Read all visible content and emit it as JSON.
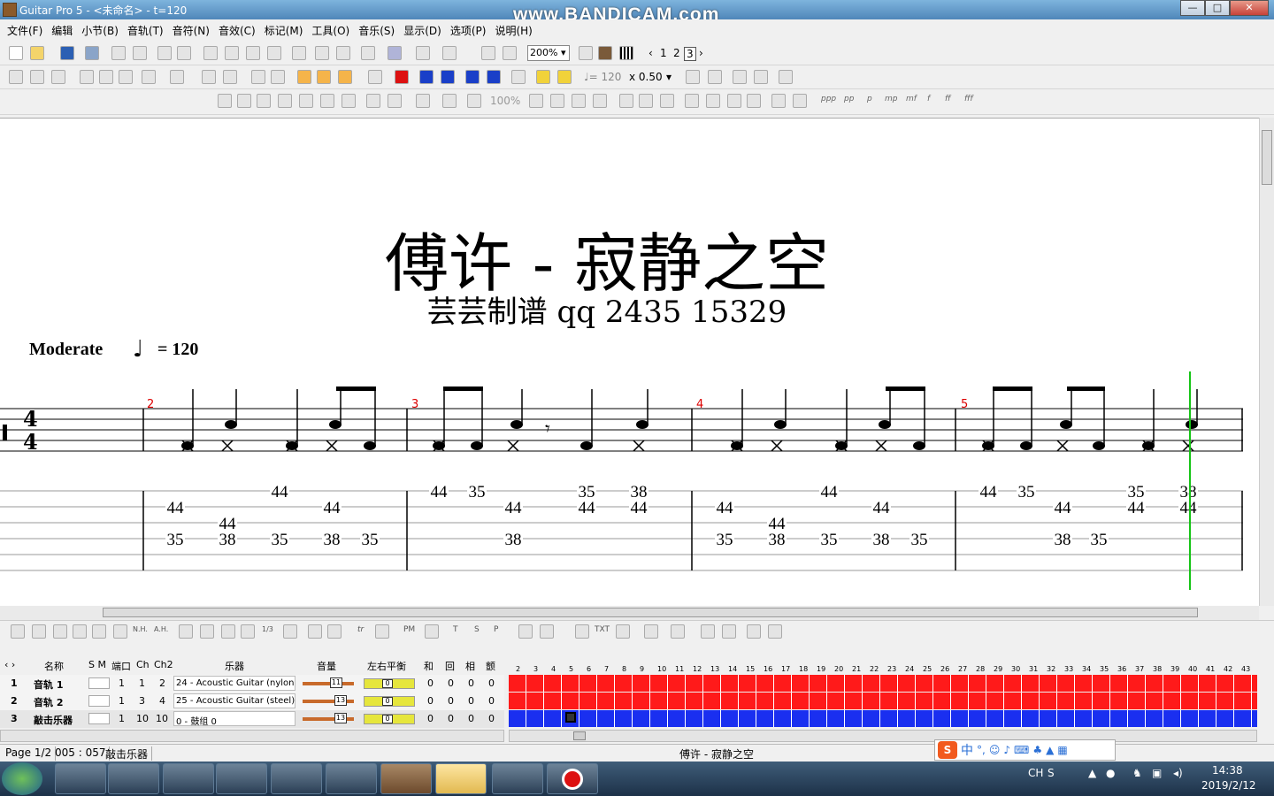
{
  "window": {
    "title": "Guitar Pro 5 - <未命名> - t=120",
    "watermark": "www.BANDICAM.com",
    "controls": {
      "minimize": "—",
      "maximize": "□",
      "close": "✕"
    }
  },
  "menu": [
    "文件(F)",
    "编辑",
    "小节(B)",
    "音轨(T)",
    "音符(N)",
    "音效(C)",
    "标记(M)",
    "工具(O)",
    "音乐(S)",
    "显示(D)",
    "选项(P)",
    "说明(H)"
  ],
  "toolbar1": {
    "zoom": "200%",
    "page_prev": "‹",
    "pages": [
      "1",
      "2",
      "3"
    ],
    "page_next": "›"
  },
  "toolbar2": {
    "tempo": "♩= 120",
    "speed": "x 0.50"
  },
  "toolbar3": {
    "percent": "100%",
    "dynamics": [
      "ppp",
      "pp",
      "p",
      "mp",
      "mf",
      "f",
      "ff",
      "fff"
    ]
  },
  "score": {
    "title": "傅许 - 寂静之空",
    "subtitle": "芸芸制谱   qq  2435  15329",
    "tempo_label": "Moderate",
    "tempo_note": "♩",
    "tempo_value": "= 120",
    "time_signature": [
      "4",
      "4"
    ],
    "measure_numbers": [
      "2",
      "3",
      "4",
      "5"
    ],
    "tab_numbers": {
      "m2": [
        [
          "44",
          "35"
        ],
        [
          "44",
          "38"
        ],
        [
          "44",
          "35"
        ],
        [
          "44",
          "38"
        ],
        [
          "35"
        ]
      ],
      "m3": [
        [
          "44"
        ],
        [
          "35"
        ],
        [
          "44",
          "38"
        ],
        [
          "35",
          "44"
        ],
        [
          "38",
          "44"
        ]
      ],
      "m4": [
        [
          "44",
          "35"
        ],
        [
          "44",
          "38"
        ],
        [
          "44",
          "35"
        ],
        [
          "44",
          "38"
        ],
        [
          "35"
        ]
      ],
      "m5": [
        [
          "44"
        ],
        [
          "35"
        ],
        [
          "44",
          "38"
        ],
        [
          "35"
        ],
        [
          "35",
          "44"
        ],
        [
          "38",
          "44"
        ]
      ]
    }
  },
  "effects_bar": {
    "labels": [
      "N.H.",
      "A.H.",
      "1/3",
      "tr",
      "PM",
      "T",
      "S",
      "P",
      "TXT"
    ]
  },
  "tracks": {
    "headers": {
      "name": "名称",
      "sm": "S M",
      "port": "端口",
      "ch": "Ch",
      "ch2": "Ch2",
      "instrument": "乐器",
      "volume": "音量",
      "pan": "左右平衡",
      "chorus": "和",
      "reverb": "回",
      "phaser": "相",
      "tremolo": "颤"
    },
    "rows": [
      {
        "num": "1",
        "name": "音轨 1",
        "port": "1",
        "ch": "1",
        "ch2": "2",
        "instrument": "24 - Acoustic Guitar (nylon)",
        "vol": "11",
        "pan": "0",
        "c1": "0",
        "c2": "0",
        "c3": "0",
        "c4": "0",
        "color": "#ff1a1a"
      },
      {
        "num": "2",
        "name": "音轨 2",
        "port": "1",
        "ch": "3",
        "ch2": "4",
        "instrument": "25 - Acoustic Guitar (steel)",
        "vol": "13",
        "pan": "0",
        "c1": "0",
        "c2": "0",
        "c3": "0",
        "c4": "0",
        "color": "#ff1a1a"
      },
      {
        "num": "3",
        "name": "敲击乐器",
        "port": "1",
        "ch": "10",
        "ch2": "10",
        "instrument": "0 - 鼓组 0",
        "vol": "13",
        "pan": "0",
        "c1": "0",
        "c2": "0",
        "c3": "0",
        "c4": "0",
        "color": "#1a2ff0"
      }
    ],
    "bar_numbers": [
      "2",
      "3",
      "4",
      "5",
      "6",
      "7",
      "8",
      "9",
      "10",
      "11",
      "12",
      "13",
      "14",
      "15",
      "16",
      "17",
      "18",
      "19",
      "20",
      "21",
      "22",
      "23",
      "24",
      "25",
      "26",
      "27",
      "28",
      "29",
      "30",
      "31",
      "32",
      "33",
      "34",
      "35",
      "36",
      "37",
      "38",
      "39",
      "40",
      "41",
      "42",
      "43"
    ]
  },
  "status": {
    "page": "Page 1/2",
    "position": "005 : 057",
    "track": "敲击乐器",
    "song": "傅许 - 寂静之空"
  },
  "taskbar": {
    "ime": "CH",
    "time": "14:38",
    "date": "2019/2/12"
  }
}
